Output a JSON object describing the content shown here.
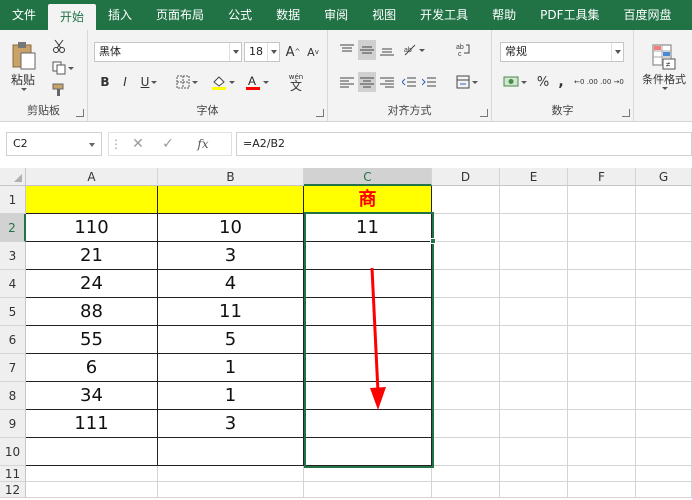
{
  "tabs": [
    "文件",
    "开始",
    "插入",
    "页面布局",
    "公式",
    "数据",
    "审阅",
    "视图",
    "开发工具",
    "帮助",
    "PDF工具集",
    "百度网盘"
  ],
  "active_tab": "开始",
  "ribbon": {
    "clipboard": {
      "paste_label": "粘贴",
      "group_label": "剪贴板"
    },
    "font": {
      "font_name": "黑体",
      "font_size": "18",
      "grow_label": "A",
      "shrink_label": "A",
      "bold": "B",
      "italic": "I",
      "underline": "U",
      "phonetic_glyph": "文",
      "phonetic_small": "wén",
      "group_label": "字体"
    },
    "alignment": {
      "group_label": "对齐方式"
    },
    "number": {
      "format": "常规",
      "percent": "%",
      "comma": ",",
      "inc_decimal": "←0 .00",
      "dec_decimal": ".00 →0",
      "group_label": "数字"
    },
    "styles": {
      "conditional_label": "条件格式"
    }
  },
  "formula_bar": {
    "name_box": "C2",
    "fx": "fx",
    "formula": "=A2/B2"
  },
  "columns": [
    "A",
    "B",
    "C",
    "D",
    "E",
    "F",
    "G"
  ],
  "rows": [
    "1",
    "2",
    "3",
    "4",
    "5",
    "6",
    "7",
    "8",
    "9",
    "10",
    "11",
    "12"
  ],
  "header_row": {
    "a": "",
    "b": "",
    "c": "商"
  },
  "data": [
    {
      "a": "110",
      "b": "10",
      "c": "11"
    },
    {
      "a": "21",
      "b": "3",
      "c": ""
    },
    {
      "a": "24",
      "b": "4",
      "c": ""
    },
    {
      "a": "88",
      "b": "11",
      "c": ""
    },
    {
      "a": "55",
      "b": "5",
      "c": ""
    },
    {
      "a": "6",
      "b": "1",
      "c": ""
    },
    {
      "a": "34",
      "b": "1",
      "c": ""
    },
    {
      "a": "111",
      "b": "3",
      "c": ""
    },
    {
      "a": "",
      "b": "",
      "c": ""
    }
  ],
  "colors": {
    "excel_green": "#217346",
    "header_fill": "#ffff00",
    "header_text": "#ff0000",
    "arrow": "#ff0000"
  },
  "icons": [
    "scissors-icon",
    "copy-icon",
    "format-painter-icon",
    "borders-icon",
    "fill-color-icon",
    "font-color-icon",
    "wrap-text-icon",
    "merge-icon",
    "currency-icon",
    "conditional-format-icon"
  ]
}
